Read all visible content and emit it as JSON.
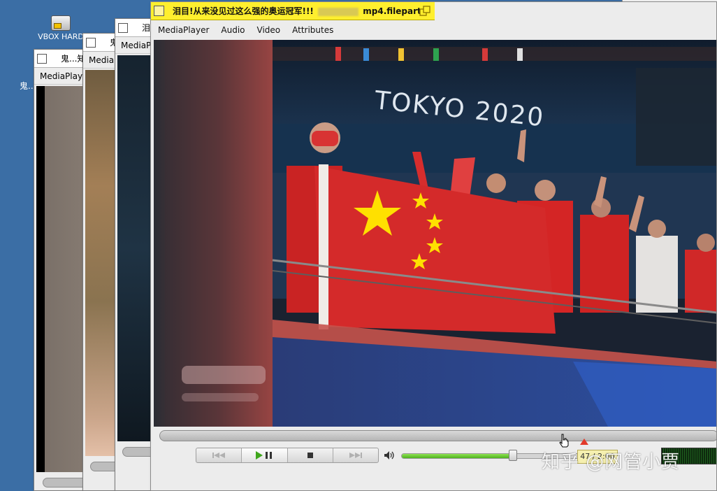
{
  "desktop": {
    "icon_label": "VBOX HARD",
    "ghost_label": "鬼..."
  },
  "windows": {
    "w1": {
      "title": "鬼...知",
      "menu": "MediaPlaye"
    },
    "w2": {
      "title": "鬼",
      "menu": "MediaP"
    },
    "w3": {
      "title": "泪",
      "menu": "MediaP"
    }
  },
  "main": {
    "title_prefix": "泪目!从来没见过这么强的奥运冠军!!!",
    "title_suffix": "mp4.filepart",
    "menu": [
      "MediaPlayer",
      "Audio",
      "Video",
      "Attributes"
    ],
    "video_caption": "TOKYO 2020",
    "seek_progress": 0.76,
    "volume_level": 0.55,
    "time_display": "47 / 2:00",
    "controls": [
      "prev",
      "play-pause",
      "stop",
      "next"
    ]
  },
  "watermark": "知乎 @网管小贾",
  "colors": {
    "desktop": "#3b6ea5",
    "active_title": "#ffef2e",
    "volume_green": "#4fb320",
    "flag_red": "#d42a2a",
    "star_yellow": "#ffe000"
  }
}
